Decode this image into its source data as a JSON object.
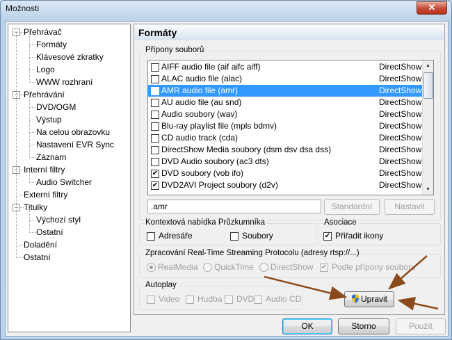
{
  "window": {
    "title": "Možnosti",
    "close": "✕"
  },
  "tree": [
    {
      "label": "Přehrávač",
      "level": 0,
      "expander": "−"
    },
    {
      "label": "Formáty",
      "level": 1
    },
    {
      "label": "Klávesové zkratky",
      "level": 1
    },
    {
      "label": "Logo",
      "level": 1
    },
    {
      "label": "WWW rozhraní",
      "level": 1
    },
    {
      "label": "Přehrávání",
      "level": 0,
      "expander": "−"
    },
    {
      "label": "DVD/OGM",
      "level": 1
    },
    {
      "label": "Výstup",
      "level": 1
    },
    {
      "label": "Na celou obrazovku",
      "level": 1
    },
    {
      "label": "Nastavení EVR Sync",
      "level": 1
    },
    {
      "label": "Záznam",
      "level": 1
    },
    {
      "label": "Interní filtry",
      "level": 0,
      "expander": "−"
    },
    {
      "label": "Audio Switcher",
      "level": 1
    },
    {
      "label": "Externí filtry",
      "level": 0
    },
    {
      "label": "Titulky",
      "level": 0,
      "expander": "−"
    },
    {
      "label": "Výchozí styl",
      "level": 1
    },
    {
      "label": "Ostatní",
      "level": 1
    },
    {
      "label": "Doladění",
      "level": 0
    },
    {
      "label": "Ostatní",
      "level": 0
    }
  ],
  "panel": {
    "header": "Formáty",
    "extensions_group": "Přípony souborů",
    "formats": [
      {
        "name": "AIFF audio file (aif aifc aiff)",
        "type": "DirectShow",
        "checked": false
      },
      {
        "name": "ALAC audio file (alac)",
        "type": "DirectShow",
        "checked": false
      },
      {
        "name": "AMR audio file (amr)",
        "type": "DirectShow",
        "checked": false,
        "selected": true
      },
      {
        "name": "AU audio file (au snd)",
        "type": "DirectShow",
        "checked": false
      },
      {
        "name": "Audio soubory (wav)",
        "type": "DirectShow",
        "checked": false
      },
      {
        "name": "Blu-ray playlist file (mpls bdmv)",
        "type": "DirectShow",
        "checked": false
      },
      {
        "name": "CD audio track (cda)",
        "type": "DirectShow",
        "checked": false
      },
      {
        "name": "DirectShow Media soubory (dsm dsv dsa dss)",
        "type": "DirectShow",
        "checked": false
      },
      {
        "name": "DVD Audio soubory (ac3 dts)",
        "type": "DirectShow",
        "checked": false
      },
      {
        "name": "DVD soubory (vob ifo)",
        "type": "DirectShow",
        "checked": true
      },
      {
        "name": "DVD2AVI Project soubory (d2v)",
        "type": "DirectShow",
        "checked": true
      }
    ],
    "ext_value": ".amr",
    "default_btn": "Standardní",
    "set_btn": "Nastavit",
    "context_group": "Kontextová nabídka Průzkumníka",
    "ctx_folders": "Adresáře",
    "ctx_files": "Soubory",
    "assoc_group": "Asociace",
    "assoc_icons": "Přiřadit ikony",
    "rtsp_group": "Zpracování Real-Time Streaming Protocolu (adresy rtsp://...)",
    "rtsp_realmedia": "RealMedia",
    "rtsp_quicktime": "QuickTime",
    "rtsp_directshow": "DirectShow",
    "rtsp_byext": "Podle přípony souboru",
    "autoplay_group": "Autoplay",
    "ap_video": "Video",
    "ap_music": "Hudba",
    "ap_dvd": "DVD",
    "ap_audiocd": "Audio CD",
    "edit_btn": "Upravit"
  },
  "footer": {
    "ok": "OK",
    "cancel": "Storno",
    "apply": "Použít"
  },
  "colors": {
    "selection": "#3399ff",
    "arrow": "#8b4a1c"
  }
}
